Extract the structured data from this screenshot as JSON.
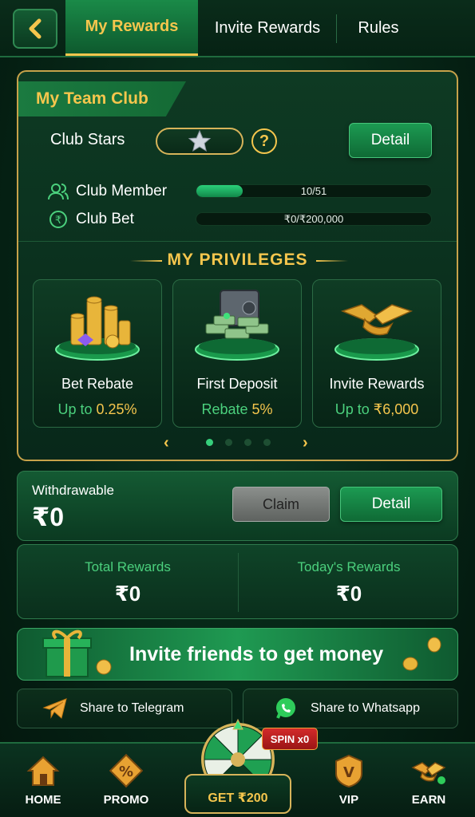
{
  "header": {
    "tabs": [
      {
        "label": "My Rewards",
        "active": true
      },
      {
        "label": "Invite Rewards",
        "active": false
      },
      {
        "label": "Rules",
        "active": false
      }
    ]
  },
  "club": {
    "title": "My Team Club",
    "stars_label": "Club Stars",
    "detail_label": "Detail",
    "member_label": "Club Member",
    "member_progress": "10/51",
    "member_fraction": 0.196,
    "bet_label": "Club Bet",
    "bet_progress": "₹0/₹200,000",
    "bet_fraction": 0
  },
  "privileges": {
    "title": "MY PRIVILEGES",
    "cards": [
      {
        "name": "Bet Rebate",
        "sub_prefix": "Up to",
        "sub_value": "0.25%"
      },
      {
        "name": "First Deposit",
        "sub_prefix": "Rebate",
        "sub_value": "5%"
      },
      {
        "name": "Invite Rewards",
        "sub_prefix": "Up to",
        "sub_value": "₹6,000"
      }
    ],
    "page_count": 4,
    "current_page": 1
  },
  "withdraw": {
    "label": "Withdrawable",
    "amount": "₹0",
    "claim_label": "Claim",
    "detail_label": "Detail"
  },
  "rewards": {
    "total_label": "Total Rewards",
    "total_value": "₹0",
    "today_label": "Today's Rewards",
    "today_value": "₹0"
  },
  "invite": {
    "banner_text": "Invite friends to get money",
    "telegram_label": "Share to Telegram",
    "whatsapp_label": "Share to Whatsapp"
  },
  "nav": {
    "home": "HOME",
    "promo": "PROMO",
    "get": "GET ₹200",
    "spin_badge": "SPIN x0",
    "vip": "VIP",
    "earn": "EARN"
  },
  "colors": {
    "gold": "#f5c64d",
    "green_accent": "#4bd07d",
    "bg": "#062516"
  }
}
